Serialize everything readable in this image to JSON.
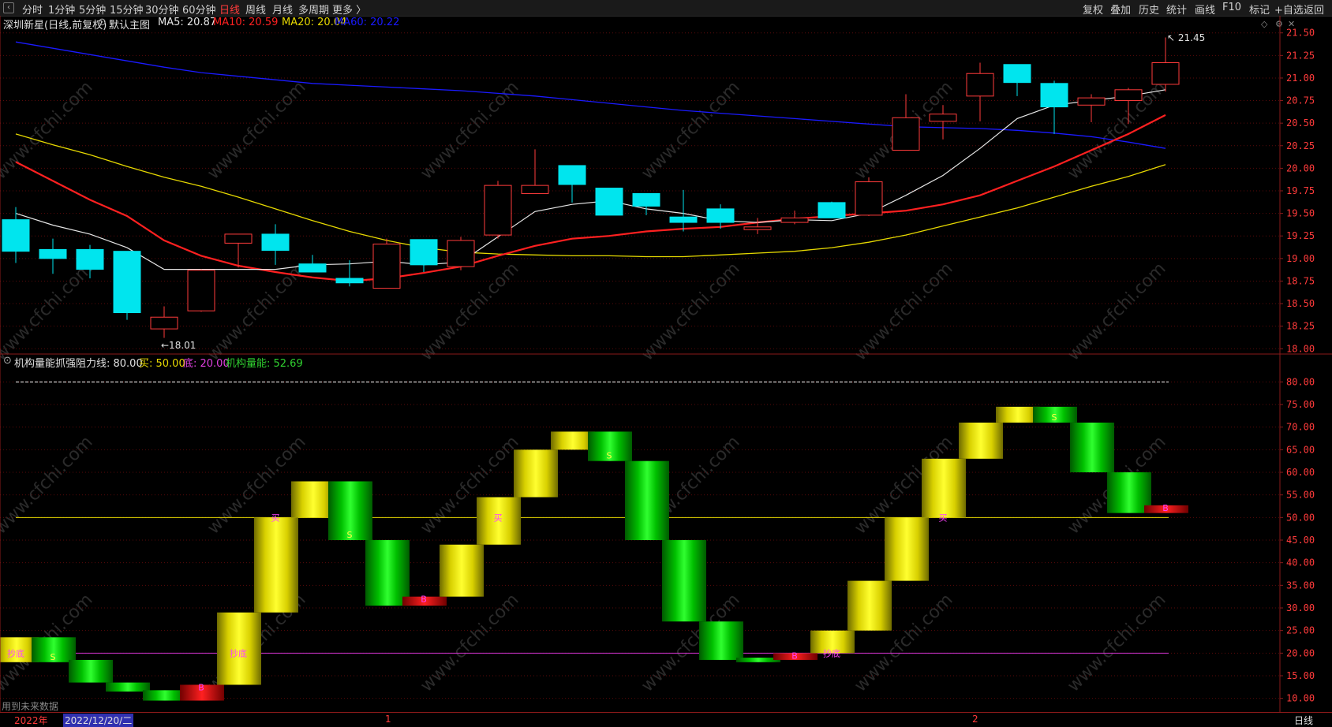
{
  "toolbar": {
    "left": [
      "分时",
      "1分钟",
      "5分钟",
      "15分钟",
      "30分钟",
      "60分钟",
      "日线",
      "周线",
      "月线",
      "多周期",
      "更多 〉"
    ],
    "active": "日线",
    "right": [
      "复权",
      "叠加",
      "历史",
      "统计",
      "画线",
      "F10",
      "标记",
      "+自选",
      "返回"
    ]
  },
  "main_title": {
    "name": "深圳新星(日线,前复权)",
    "indicator": "默认主图",
    "ma5": "MA5: 20.87",
    "ma10": "MA10: 20.59",
    "ma20": "MA20: 20.04",
    "ma60": "MA60: 20.22"
  },
  "colors": {
    "up": "#ff3b3b",
    "down": "#00e5ee",
    "ma5": "#e6e6e6",
    "ma10": "#ff2020",
    "ma20": "#e6d800",
    "ma60": "#1a1aff",
    "buy_line": "#e6d800",
    "bottom_line": "#cc33cc"
  },
  "price_axis": [
    "21.50",
    "21.25",
    "21.00",
    "20.75",
    "20.50",
    "20.25",
    "20.00",
    "19.75",
    "19.50",
    "19.25",
    "19.00",
    "18.75",
    "18.50",
    "18.25",
    "18.00"
  ],
  "price_marks": {
    "high": "21.45",
    "low": "18.01"
  },
  "sub_title": {
    "name": "机构量能抓强",
    "resist": "阻力线: 80.00",
    "buy": "买: 50.00",
    "bottom": "底: 20.00",
    "energy": "机构量能: 52.69"
  },
  "sub_axis": [
    "80.00",
    "75.00",
    "70.00",
    "65.00",
    "60.00",
    "55.00",
    "50.00",
    "45.00",
    "40.00",
    "35.00",
    "30.00",
    "25.00",
    "20.00",
    "15.00",
    "10.00"
  ],
  "footer_note": "用到未来数据",
  "bottom_axis": {
    "year": "2022年",
    "date": "2022/12/20/二",
    "m1": "1",
    "m2": "2",
    "period": "日线"
  },
  "watermark": "www.cfchi.com",
  "chart_data": [
    {
      "type": "candlestick",
      "title": "深圳新星(日线,前复权)",
      "ylim": [
        17.95,
        21.55
      ],
      "candles": [
        {
          "o": 19.43,
          "c": 19.08,
          "h": 19.57,
          "l": 18.95
        },
        {
          "o": 19.1,
          "c": 19.0,
          "h": 19.22,
          "l": 18.83
        },
        {
          "o": 19.1,
          "c": 18.88,
          "h": 19.15,
          "l": 18.78
        },
        {
          "o": 19.08,
          "c": 18.4,
          "h": 19.08,
          "l": 18.32
        },
        {
          "o": 18.22,
          "c": 18.35,
          "h": 18.47,
          "l": 18.12
        },
        {
          "o": 18.42,
          "c": 18.87,
          "h": 18.88,
          "l": 18.41
        },
        {
          "o": 19.17,
          "c": 19.27,
          "h": 19.27,
          "l": 18.9
        },
        {
          "o": 19.27,
          "c": 19.09,
          "h": 19.38,
          "l": 18.93
        },
        {
          "o": 18.94,
          "c": 18.85,
          "h": 19.04,
          "l": 18.85
        },
        {
          "o": 18.78,
          "c": 18.73,
          "h": 18.98,
          "l": 18.69
        },
        {
          "o": 18.67,
          "c": 19.16,
          "h": 19.22,
          "l": 18.67
        },
        {
          "o": 19.21,
          "c": 18.93,
          "h": 19.21,
          "l": 18.85
        },
        {
          "o": 18.91,
          "c": 19.2,
          "h": 19.24,
          "l": 18.87
        },
        {
          "o": 19.26,
          "c": 19.81,
          "h": 19.86,
          "l": 19.22
        },
        {
          "o": 19.72,
          "c": 19.81,
          "h": 20.21,
          "l": 19.73
        },
        {
          "o": 20.03,
          "c": 19.82,
          "h": 20.03,
          "l": 19.62
        },
        {
          "o": 19.78,
          "c": 19.48,
          "h": 19.78,
          "l": 19.48
        },
        {
          "o": 19.72,
          "c": 19.58,
          "h": 19.72,
          "l": 19.48
        },
        {
          "o": 19.46,
          "c": 19.4,
          "h": 19.76,
          "l": 19.3
        },
        {
          "o": 19.55,
          "c": 19.4,
          "h": 19.6,
          "l": 19.33
        },
        {
          "o": 19.32,
          "c": 19.35,
          "h": 19.45,
          "l": 19.27
        },
        {
          "o": 19.4,
          "c": 19.45,
          "h": 19.53,
          "l": 19.38
        },
        {
          "o": 19.62,
          "c": 19.45,
          "h": 19.63,
          "l": 19.45
        },
        {
          "o": 19.48,
          "c": 19.85,
          "h": 19.9,
          "l": 19.47
        },
        {
          "o": 20.2,
          "c": 20.56,
          "h": 20.82,
          "l": 20.2
        },
        {
          "o": 20.52,
          "c": 20.6,
          "h": 20.7,
          "l": 20.32
        },
        {
          "o": 20.8,
          "c": 21.05,
          "h": 21.17,
          "l": 20.52
        },
        {
          "o": 21.15,
          "c": 20.95,
          "h": 21.15,
          "l": 20.8
        },
        {
          "o": 20.94,
          "c": 20.68,
          "h": 20.97,
          "l": 20.38
        },
        {
          "o": 20.7,
          "c": 20.78,
          "h": 20.82,
          "l": 20.51
        },
        {
          "o": 20.75,
          "c": 20.87,
          "h": 20.89,
          "l": 20.49
        },
        {
          "o": 20.93,
          "c": 21.17,
          "h": 21.45,
          "l": 20.85
        }
      ],
      "ma5": [
        19.5,
        19.37,
        19.27,
        19.12,
        18.88,
        18.88,
        18.88,
        18.88,
        18.93,
        18.94,
        18.97,
        18.93,
        18.96,
        19.24,
        19.52,
        19.6,
        19.64,
        19.55,
        19.5,
        19.42,
        19.4,
        19.43,
        19.42,
        19.5,
        19.7,
        19.92,
        20.22,
        20.55,
        20.7,
        20.75,
        20.8,
        20.87
      ],
      "ma10": [
        20.07,
        19.86,
        19.65,
        19.47,
        19.2,
        19.03,
        18.92,
        18.85,
        18.79,
        18.75,
        18.78,
        18.84,
        18.91,
        19.03,
        19.14,
        19.22,
        19.25,
        19.3,
        19.33,
        19.35,
        19.4,
        19.44,
        19.47,
        19.5,
        19.53,
        19.6,
        19.7,
        19.86,
        20.02,
        20.2,
        20.38,
        20.59
      ],
      "ma20": [
        20.38,
        20.26,
        20.15,
        20.02,
        19.9,
        19.8,
        19.68,
        19.55,
        19.42,
        19.3,
        19.2,
        19.12,
        19.07,
        19.05,
        19.04,
        19.03,
        19.03,
        19.02,
        19.02,
        19.04,
        19.06,
        19.08,
        19.12,
        19.18,
        19.26,
        19.36,
        19.46,
        19.56,
        19.68,
        19.8,
        19.91,
        20.04
      ],
      "ma60": [
        21.4,
        21.33,
        21.26,
        21.19,
        21.12,
        21.06,
        21.02,
        20.98,
        20.94,
        20.92,
        20.9,
        20.88,
        20.86,
        20.83,
        20.8,
        20.76,
        20.72,
        20.68,
        20.64,
        20.61,
        20.58,
        20.55,
        20.52,
        20.49,
        20.46,
        20.45,
        20.44,
        20.42,
        20.39,
        20.35,
        20.29,
        20.22
      ]
    },
    {
      "type": "bar",
      "title": "机构量能抓强",
      "ylim": [
        7.5,
        82.5
      ],
      "bars": [
        {
          "lo": 18.0,
          "hi": 23.5,
          "color": "yellow",
          "label": "抄底"
        },
        {
          "lo": 18.0,
          "hi": 23.5,
          "color": "green",
          "label": "S"
        },
        {
          "lo": 13.5,
          "hi": 18.5,
          "color": "green",
          "label": ""
        },
        {
          "lo": 11.5,
          "hi": 13.5,
          "color": "green",
          "label": ""
        },
        {
          "lo": 9.5,
          "hi": 11.8,
          "color": "green",
          "label": ""
        },
        {
          "lo": 9.5,
          "hi": 13.0,
          "color": "red",
          "label": "B"
        },
        {
          "lo": 13.0,
          "hi": 29.0,
          "color": "yellow",
          "label": "抄底"
        },
        {
          "lo": 29.0,
          "hi": 50.0,
          "color": "yellow",
          "label": "买"
        },
        {
          "lo": 50.0,
          "hi": 58.0,
          "color": "yellow",
          "label": ""
        },
        {
          "lo": 45.0,
          "hi": 58.0,
          "color": "green",
          "label": "S"
        },
        {
          "lo": 30.5,
          "hi": 45.0,
          "color": "green",
          "label": ""
        },
        {
          "lo": 30.5,
          "hi": 32.5,
          "color": "red",
          "label": "B"
        },
        {
          "lo": 32.5,
          "hi": 44.0,
          "color": "yellow",
          "label": ""
        },
        {
          "lo": 44.0,
          "hi": 54.5,
          "color": "yellow",
          "label": "买"
        },
        {
          "lo": 54.5,
          "hi": 65.0,
          "color": "yellow",
          "label": ""
        },
        {
          "lo": 65.0,
          "hi": 69.0,
          "color": "yellow",
          "label": ""
        },
        {
          "lo": 62.5,
          "hi": 69.0,
          "color": "green",
          "label": "S"
        },
        {
          "lo": 45.0,
          "hi": 62.5,
          "color": "green",
          "label": ""
        },
        {
          "lo": 27.0,
          "hi": 45.0,
          "color": "green",
          "label": ""
        },
        {
          "lo": 18.5,
          "hi": 27.0,
          "color": "green",
          "label": ""
        },
        {
          "lo": 18.0,
          "hi": 19.0,
          "color": "green",
          "label": ""
        },
        {
          "lo": 18.5,
          "hi": 20.0,
          "color": "red",
          "label": "B"
        },
        {
          "lo": 20.0,
          "hi": 25.0,
          "color": "yellow",
          "label": "抄底"
        },
        {
          "lo": 25.0,
          "hi": 36.0,
          "color": "yellow",
          "label": ""
        },
        {
          "lo": 36.0,
          "hi": 50.0,
          "color": "yellow",
          "label": ""
        },
        {
          "lo": 50.0,
          "hi": 63.0,
          "color": "yellow",
          "label": "买"
        },
        {
          "lo": 63.0,
          "hi": 71.0,
          "color": "yellow",
          "label": ""
        },
        {
          "lo": 71.0,
          "hi": 74.5,
          "color": "yellow",
          "label": ""
        },
        {
          "lo": 71.0,
          "hi": 74.5,
          "color": "green",
          "label": "S"
        },
        {
          "lo": 60.0,
          "hi": 71.0,
          "color": "green",
          "label": ""
        },
        {
          "lo": 51.0,
          "hi": 60.0,
          "color": "green",
          "label": ""
        },
        {
          "lo": 51.0,
          "hi": 52.7,
          "color": "red",
          "label": "B"
        }
      ],
      "lines": {
        "resist": 80,
        "buy": 50,
        "bottom": 20
      }
    }
  ]
}
